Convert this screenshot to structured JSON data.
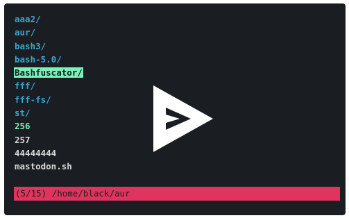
{
  "entries": [
    {
      "name": "aaa2/",
      "kind": "dir"
    },
    {
      "name": "aur/",
      "kind": "dir"
    },
    {
      "name": "bash3/",
      "kind": "dir"
    },
    {
      "name": "bash-5.0/",
      "kind": "dir"
    },
    {
      "name": "Bashfuscator/",
      "kind": "dir",
      "selected": true
    },
    {
      "name": "fff/",
      "kind": "dir"
    },
    {
      "name": "fff-fs/",
      "kind": "dir"
    },
    {
      "name": "st/",
      "kind": "dir"
    },
    {
      "name": "256",
      "kind": "num"
    },
    {
      "name": "257",
      "kind": "file"
    },
    {
      "name": "44444444",
      "kind": "file"
    },
    {
      "name": "mastodon.sh",
      "kind": "file"
    }
  ],
  "status": {
    "text": "(5/15) /home/black/aur"
  },
  "overlay": {
    "icon": "play-icon"
  },
  "colors": {
    "background": "#1a1d21",
    "directory": "#3aa6d1",
    "file": "#d6d6d6",
    "highlight": "#7ef0b9",
    "statusbar": "#e0345f"
  }
}
